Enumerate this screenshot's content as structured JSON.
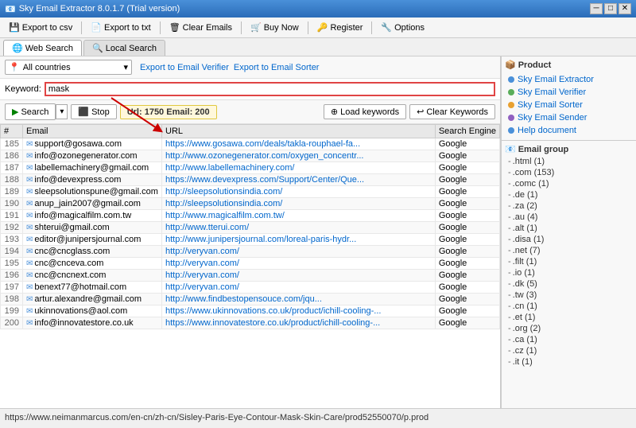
{
  "titleBar": {
    "icon": "📧",
    "title": "Sky Email Extractor 8.0.1.7 (Trial version)",
    "minBtn": "─",
    "maxBtn": "□",
    "closeBtn": "✕"
  },
  "toolbar": {
    "exportCsv": "Export to csv",
    "exportTxt": "Export to txt",
    "clearEmails": "Clear Emails",
    "buyNow": "Buy Now",
    "register": "Register",
    "options": "Options"
  },
  "tabs": {
    "webSearch": "Web Search",
    "localSearch": "Local Search"
  },
  "searchTop": {
    "countryPlaceholder": "All countries",
    "exportVerifier": "Export to Email Verifier",
    "exportSorter": "Export to Email Sorter"
  },
  "keyword": {
    "label": "Keyword:",
    "value": "mask"
  },
  "buttons": {
    "search": "Search",
    "stop": "Stop",
    "status": "Url: 1750 Email: 200",
    "loadKeywords": "Load keywords",
    "clearKeywords": "Clear Keywords"
  },
  "tableHeaders": {
    "num": "#",
    "email": "Email",
    "url": "URL",
    "engine": "Search Engine"
  },
  "tableRows": [
    {
      "num": "185",
      "email": "support@gosawa.com",
      "url": "https://www.gosawa.com/deals/takla-rouphael-fa...",
      "engine": "Google"
    },
    {
      "num": "186",
      "email": "info@ozonegenerator.com",
      "url": "http://www.ozonegenerator.com/oxygen_concentr...",
      "engine": "Google"
    },
    {
      "num": "187",
      "email": "labellemachinery@gmail.com",
      "url": "http://www.labellemachinery.com/",
      "engine": "Google"
    },
    {
      "num": "188",
      "email": "info@devexpress.com",
      "url": "https://www.devexpress.com/Support/Center/Que...",
      "engine": "Google"
    },
    {
      "num": "189",
      "email": "sleepsolutionspune@gmail.com",
      "url": "http://sleepsolutionsindia.com/",
      "engine": "Google"
    },
    {
      "num": "190",
      "email": "anup_jain2007@gmail.com",
      "url": "http://sleepsolutionsindia.com/",
      "engine": "Google"
    },
    {
      "num": "191",
      "email": "info@magicalfilm.com.tw",
      "url": "http://www.magicalfilm.com.tw/",
      "engine": "Google"
    },
    {
      "num": "192",
      "email": "shterui@gmail.com",
      "url": "http://www.tterui.com/",
      "engine": "Google"
    },
    {
      "num": "193",
      "email": "editor@junipersjournal.com",
      "url": "http://www.junipersjournal.com/loreal-paris-hydr...",
      "engine": "Google"
    },
    {
      "num": "194",
      "email": "cnc@cncglass.com",
      "url": "http://veryvan.com/",
      "engine": "Google"
    },
    {
      "num": "195",
      "email": "cnc@cnceva.com",
      "url": "http://veryvan.com/",
      "engine": "Google"
    },
    {
      "num": "196",
      "email": "cnc@cncnext.com",
      "url": "http://veryvan.com/",
      "engine": "Google"
    },
    {
      "num": "197",
      "email": "benext77@hotmail.com",
      "url": "http://veryvan.com/",
      "engine": "Google"
    },
    {
      "num": "198",
      "email": "artur.alexandre@gmail.com",
      "url": "http://www.findbestopensouce.com/jqu...",
      "engine": "Google"
    },
    {
      "num": "199",
      "email": "ukinnovations@aol.com",
      "url": "https://www.ukinnovations.co.uk/product/ichill-cooling-...",
      "engine": "Google"
    },
    {
      "num": "200",
      "email": "info@innovatestore.co.uk",
      "url": "https://www.innovatestore.co.uk/product/ichill-cooling-...",
      "engine": "Google"
    }
  ],
  "rightPanel": {
    "productTitle": "Product",
    "products": [
      {
        "label": "Sky Email Extractor",
        "color": "blue"
      },
      {
        "label": "Sky Email Verifier",
        "color": "green"
      },
      {
        "label": "Sky Email Sorter",
        "color": "orange"
      },
      {
        "label": "Sky Email Sender",
        "color": "purple"
      },
      {
        "label": "Help document",
        "color": "blue"
      }
    ],
    "emailGroupTitle": "Email group",
    "groups": [
      {
        "label": ".html (1)"
      },
      {
        "label": ".com (153)"
      },
      {
        "label": ".comc (1)"
      },
      {
        "label": ".de (1)"
      },
      {
        "label": ".za (2)"
      },
      {
        "label": ".au (4)"
      },
      {
        "label": ".alt (1)"
      },
      {
        "label": ".disa (1)"
      },
      {
        "label": ".net (7)"
      },
      {
        "label": ".filt (1)"
      },
      {
        "label": ".io (1)"
      },
      {
        "label": ".dk (5)"
      },
      {
        "label": ".tw (3)"
      },
      {
        "label": ".cn (1)"
      },
      {
        "label": ".et (1)"
      },
      {
        "label": ".org (2)"
      },
      {
        "label": ".ca (1)"
      },
      {
        "label": ".cz (1)"
      },
      {
        "label": ".it (1)"
      }
    ]
  },
  "statusBar": {
    "text": "https://www.neimanmarcus.com/en-cn/zh-cn/Sisley-Paris-Eye-Contour-Mask-Skin-Care/prod52550070/p.prod"
  }
}
